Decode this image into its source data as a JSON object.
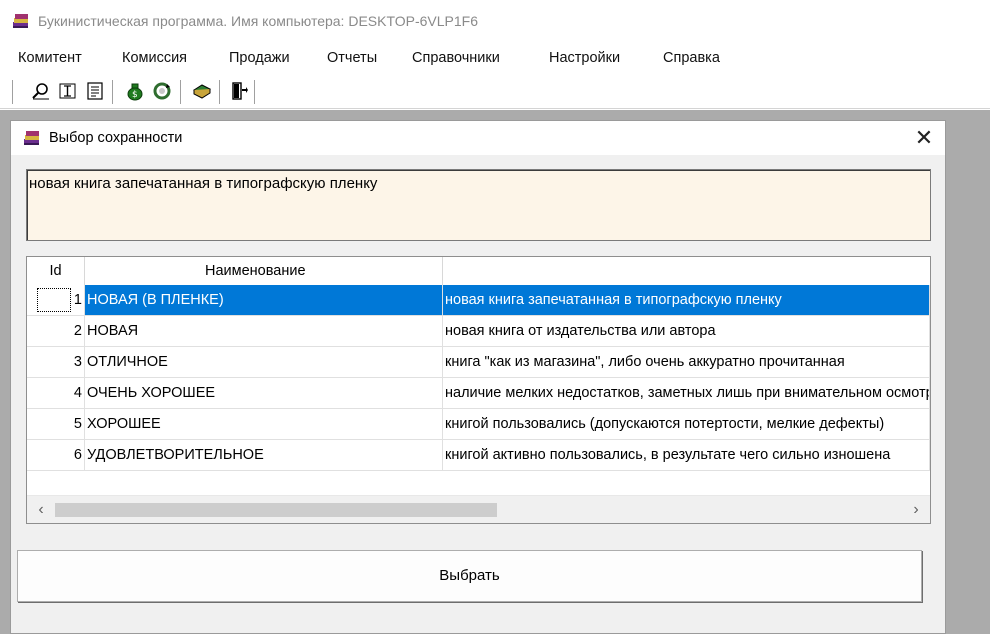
{
  "app": {
    "title": "Букинистическая программа. Имя компьютера: DESKTOP-6VLP1F6",
    "icon": "book-stack-icon"
  },
  "menu": [
    "Комитент",
    "Комиссия",
    "Продажи",
    "Отчеты",
    "Справочники",
    "Настройки",
    "Справка"
  ],
  "toolbar": {
    "icons": [
      "search-icon",
      "text-cursor-icon",
      "document-icon",
      "money-bag-icon",
      "refresh-icon",
      "book-icon",
      "exit-door-icon"
    ]
  },
  "dialog": {
    "title": "Выбор сохранности",
    "close_glyph": "✕",
    "description": "новая книга запечатанная в типографскую пленку",
    "description_bg": "#fdf5e8",
    "grid": {
      "columns": [
        "Id",
        "Наименование",
        ""
      ],
      "rows": [
        {
          "id": "1",
          "name": "НОВАЯ (В ПЛЕНКЕ)",
          "desc": "новая книга запечатанная в типографскую пленку",
          "selected": true
        },
        {
          "id": "2",
          "name": "НОВАЯ",
          "desc": "новая книга от издательства или автора"
        },
        {
          "id": "3",
          "name": "ОТЛИЧНОЕ",
          "desc": "книга \"как из магазина\", либо очень аккуратно прочитанная"
        },
        {
          "id": "4",
          "name": "ОЧЕНЬ ХОРОШЕЕ",
          "desc": "наличие мелких недостатков, заметных лишь при внимательном осмотре"
        },
        {
          "id": "5",
          "name": "ХОРОШЕЕ",
          "desc": "книгой пользовались (допускаются потертости, мелкие дефекты)"
        },
        {
          "id": "6",
          "name": "УДОВЛЕТВОРИТЕЛЬНОЕ",
          "desc": "книгой активно пользовались, в результате чего сильно изношена"
        }
      ],
      "selection_color": "#0078d7"
    },
    "scroll_left": "‹",
    "scroll_right": "›",
    "select_button": "Выбрать"
  }
}
